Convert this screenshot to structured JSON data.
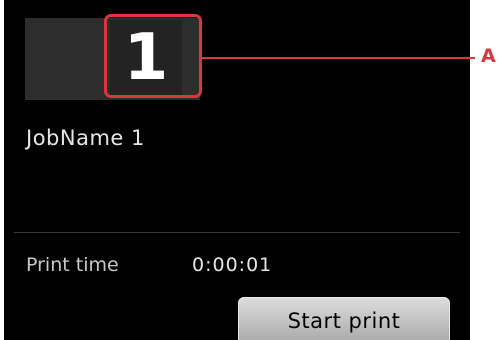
{
  "job": {
    "number": "1",
    "name": "JobName 1"
  },
  "print_time": {
    "label": "Print time",
    "value": "0:00:01"
  },
  "actions": {
    "start_label": "Start print"
  },
  "callout": {
    "label": "A"
  },
  "colors": {
    "screen_bg": "#000000",
    "highlight": "#d9363f",
    "button_bg": "#c0c0c0"
  }
}
